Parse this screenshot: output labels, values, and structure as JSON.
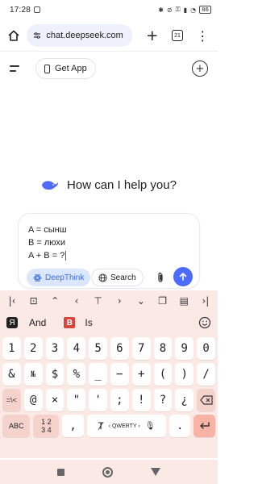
{
  "status_bar": {
    "time": "17:28",
    "battery": "86",
    "icons": [
      "bluetooth-icon",
      "mute-icon",
      "vpn-icon",
      "signal-icon",
      "wifi-icon",
      "battery-icon"
    ]
  },
  "browser": {
    "url": "chat.deepseek.com",
    "tab_count": "21",
    "icons": [
      "home-icon",
      "site-settings-icon",
      "new-tab-icon",
      "tabs-icon",
      "more-icon"
    ]
  },
  "app": {
    "get_app_label": "Get App",
    "welcome": "How can I help you?",
    "input": {
      "lines": [
        "A = сынш",
        "B = люхи",
        "A + B = ?"
      ]
    },
    "deepthink_label": "DeepThink",
    "search_label": "Search",
    "accent_color": "#4d6bfe",
    "chip_active_bg": "#dbe6ff"
  },
  "keyboard": {
    "background": "#fbe9e6",
    "suggestions": [
      "And",
      "Is"
    ],
    "row1": [
      "1",
      "2",
      "3",
      "4",
      "5",
      "6",
      "7",
      "8",
      "9",
      "0"
    ],
    "row2": [
      "&",
      "№",
      "$",
      "%",
      "_",
      "−",
      "+",
      "(",
      ")",
      "/"
    ],
    "row3": [
      "=\\<",
      "@",
      "×",
      "\"",
      "'",
      ";",
      "!",
      "?",
      "¿"
    ],
    "row4": {
      "abc": "ABC",
      "num_top": "1 2",
      "num_bottom": "3 4",
      "comma": ",",
      "space": "‹ QWERTY ›",
      "dot": "."
    }
  }
}
